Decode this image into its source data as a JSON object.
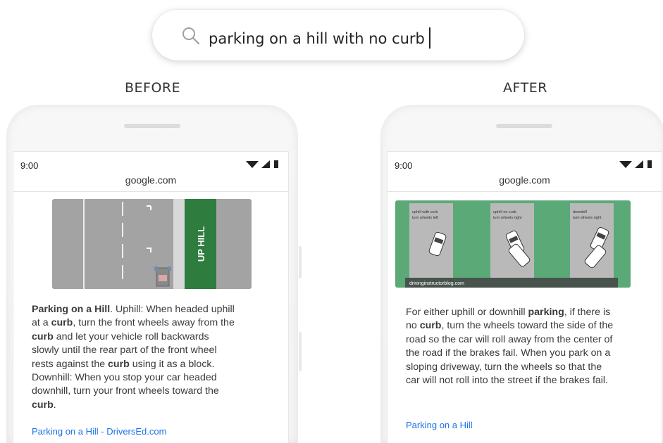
{
  "search": {
    "query": "parking on a hill with no curb"
  },
  "before": {
    "label": "BEFORE",
    "status_time": "9:00",
    "url": "google.com",
    "image_sign": "UP HILL",
    "snippet": [
      {
        "t": "Parking on a Hill",
        "b": true
      },
      {
        "t": ". Uphill: When headed uphill at a ",
        "b": false
      },
      {
        "t": "curb",
        "b": true
      },
      {
        "t": ", turn the front wheels away from the ",
        "b": false
      },
      {
        "t": "curb",
        "b": true
      },
      {
        "t": " and let your vehicle roll backwards slowly until the rear part of the front wheel rests against the ",
        "b": false
      },
      {
        "t": "curb",
        "b": true
      },
      {
        "t": " using it as a block. Downhill: When you stop your car headed downhill, turn your front wheels toward the ",
        "b": false
      },
      {
        "t": "curb",
        "b": true
      },
      {
        "t": ".",
        "b": false
      }
    ],
    "link": "Parking on a Hill - DriversEd.com"
  },
  "after": {
    "label": "AFTER",
    "status_time": "9:00",
    "url": "google.com",
    "image_panels": [
      "uphill with curb\nturn wheels left",
      "uphill no curb\nturn wheels right",
      "downhill\nturn wheels right"
    ],
    "image_caption": "drivinginstructorblog.com",
    "snippet": [
      {
        "t": "For either uphill or downhill ",
        "b": false
      },
      {
        "t": "parking",
        "b": true
      },
      {
        "t": ", if there is no ",
        "b": false
      },
      {
        "t": "curb",
        "b": true
      },
      {
        "t": ", turn the wheels toward the side of the road so the car will roll away from the center of the road if the brakes fail. When you park on a sloping driveway, turn the wheels so that the car will not roll into the street if the brakes fail.",
        "b": false
      }
    ],
    "link": "Parking on a Hill"
  },
  "colors": {
    "link": "#1a73e8",
    "road": "#a3a3a3",
    "grass": "#2e7d3e",
    "after_green": "#5aa977"
  }
}
